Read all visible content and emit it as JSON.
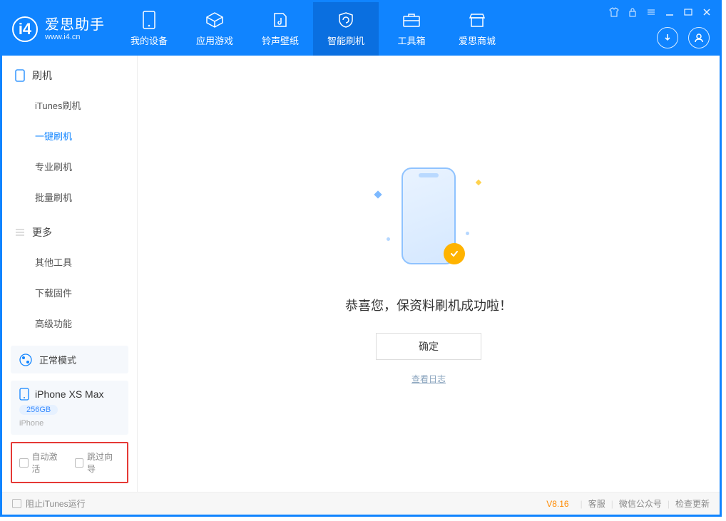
{
  "brand": {
    "name": "爱思助手",
    "site": "www.i4.cn"
  },
  "tabs": {
    "device": "我的设备",
    "apps": "应用游戏",
    "ring": "铃声壁纸",
    "flash": "智能刷机",
    "toolbox": "工具箱",
    "store": "爱思商城"
  },
  "sidebar": {
    "group_flash": "刷机",
    "itunes_flash": "iTunes刷机",
    "one_click": "一键刷机",
    "pro_flash": "专业刷机",
    "batch_flash": "批量刷机",
    "group_more": "更多",
    "other_tools": "其他工具",
    "download_fw": "下载固件",
    "advanced": "高级功能"
  },
  "mode": {
    "label": "正常模式"
  },
  "device": {
    "name": "iPhone XS Max",
    "capacity": "256GB",
    "type": "iPhone"
  },
  "checks": {
    "auto_activate": "自动激活",
    "skip_wizard": "跳过向导"
  },
  "main": {
    "message": "恭喜您，保资料刷机成功啦！",
    "ok": "确定",
    "log": "查看日志"
  },
  "footer": {
    "block_itunes": "阻止iTunes运行",
    "version": "V8.16",
    "service": "客服",
    "wechat": "微信公众号",
    "update": "检查更新"
  }
}
